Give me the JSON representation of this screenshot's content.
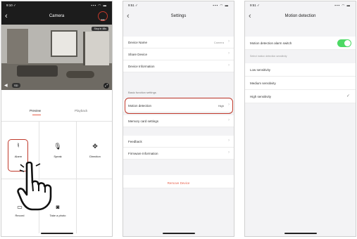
{
  "screen1": {
    "status_time": "9:10 ✓",
    "signal": "▪▪▪ ◠ ▬",
    "title": "Camera",
    "more_label": "•••",
    "overlay_badge": "Stop in 48s",
    "preview_value": "SD",
    "tabs": [
      "Preview",
      "Playback"
    ],
    "controls": [
      "Alarm",
      "Speak",
      "Direction",
      "Record",
      "Take a photo"
    ]
  },
  "screen2": {
    "status_time": "9:51 ✓",
    "signal": "▪▪▪ ◠ ▬",
    "title": "Settings",
    "rows1": [
      {
        "label": "Device Name",
        "value": "Camera"
      },
      {
        "label": "Share Device",
        "value": ""
      },
      {
        "label": "Device Information",
        "value": ""
      }
    ],
    "section_header": "Basic function settings",
    "motion_row": {
      "label": "Motion detection",
      "value": "High"
    },
    "memory_row": {
      "label": "Memory card settings",
      "value": ""
    },
    "rows2": [
      {
        "label": "Feedback",
        "value": ""
      },
      {
        "label": "Firmware Information",
        "value": ""
      }
    ],
    "remove_label": "Remove Device"
  },
  "screen3": {
    "status_time": "9:51 ✓",
    "signal": "▪▪▪ ◠ ▬",
    "title": "Motion detection",
    "switch_label": "Motion detection alarm switch",
    "select_header": "Select motion detection sensitivity",
    "options": [
      "Low sensitivity",
      "Medium sensitivity",
      "High sensitivity"
    ],
    "selected_index": 2,
    "check": "✓"
  },
  "colors": {
    "accent_green": "#4cd964",
    "remove_red": "#e8604c",
    "highlight_red": "#c0392b"
  }
}
